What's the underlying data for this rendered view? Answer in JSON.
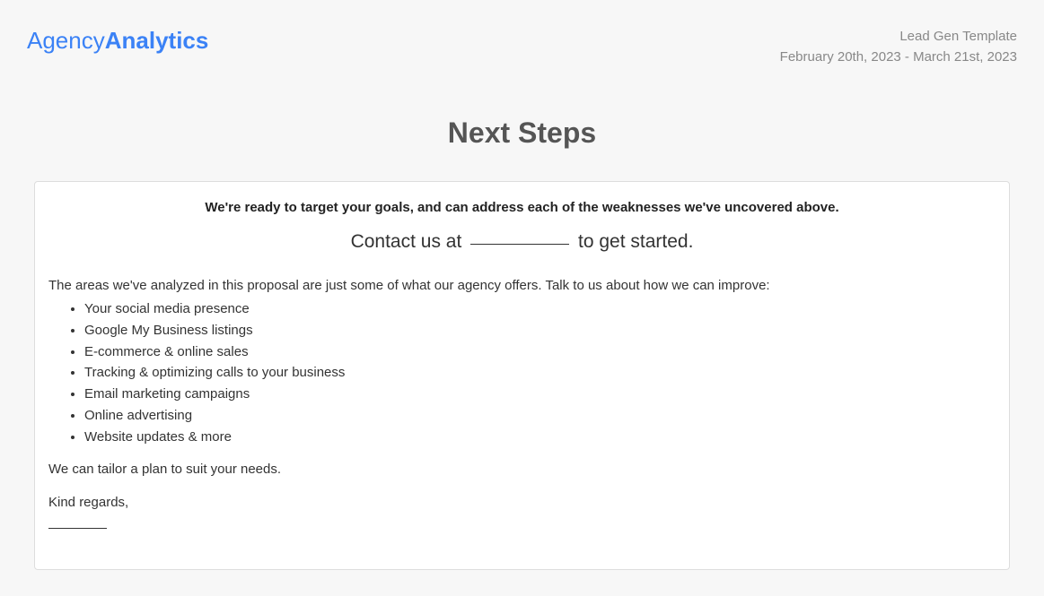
{
  "header": {
    "logo_light": "Agency",
    "logo_bold": "Analytics",
    "template_name": "Lead Gen Template",
    "date_range": "February 20th, 2023 - March 21st, 2023"
  },
  "title": "Next Steps",
  "card": {
    "headline": "We're ready to target your goals, and can address each of the weaknesses we've uncovered above.",
    "contact_prefix": "Contact us at",
    "contact_suffix": "to get started.",
    "intro": "The areas we've analyzed in this proposal are just some of what our agency offers. Talk to us about how we can improve:",
    "bullets": [
      "Your social media presence",
      "Google My Business listings",
      "E-commerce & online sales",
      "Tracking & optimizing calls to your business",
      "Email marketing campaigns",
      "Online advertising",
      "Website updates & more"
    ],
    "tailor": "We can tailor a plan to suit your needs.",
    "regards": "Kind regards,"
  }
}
